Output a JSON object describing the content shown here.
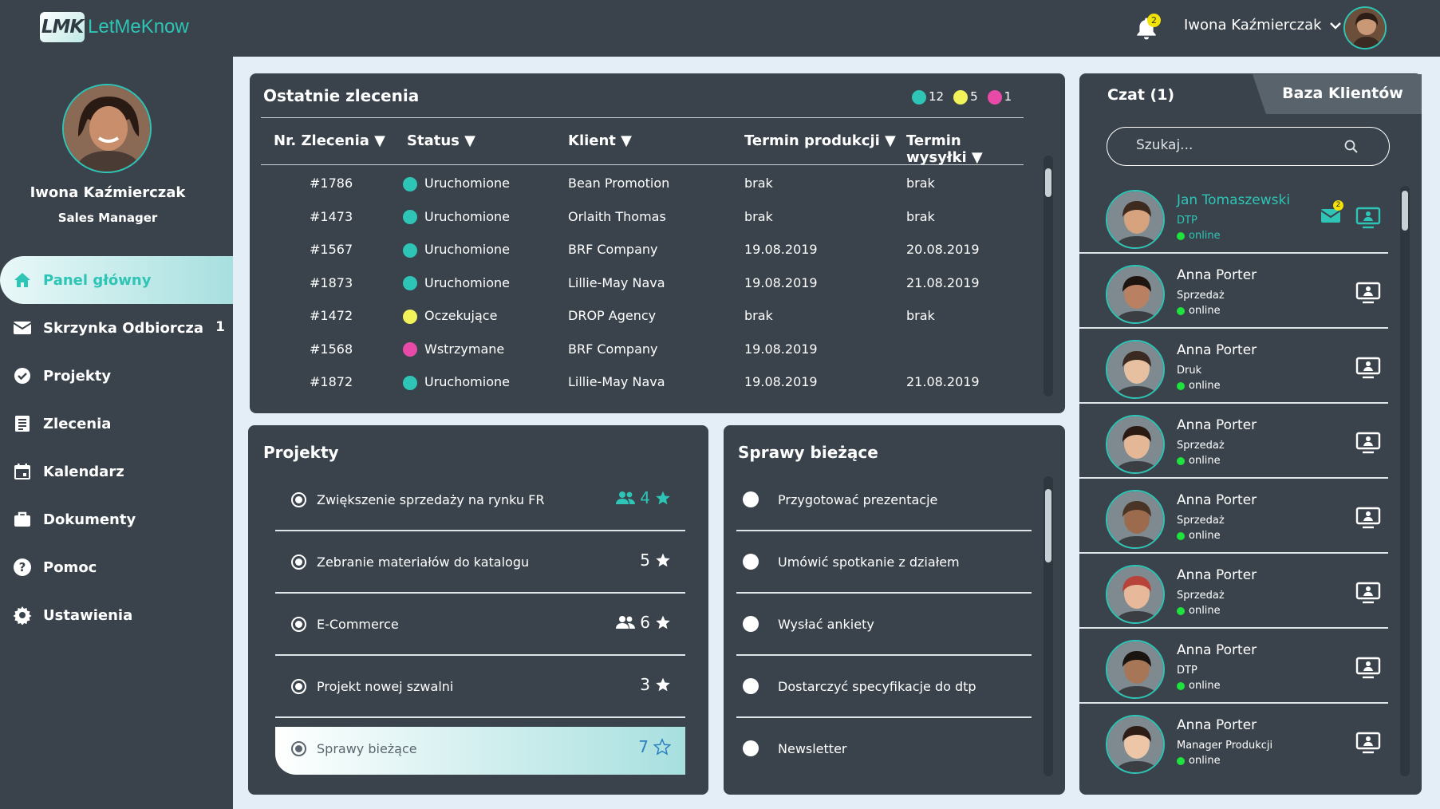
{
  "app": {
    "logo_mark": "LMK",
    "logo_name": "LetMeKnow"
  },
  "topbar": {
    "notifications_count": "2",
    "user_name": "Iwona Kaźmierczak"
  },
  "profile": {
    "name": "Iwona Kaźmierczak",
    "role": "Sales Manager"
  },
  "nav": {
    "items": [
      {
        "label": "Panel główny",
        "icon": "home-icon",
        "badge": ""
      },
      {
        "label": "Skrzynka Odbiorcza",
        "icon": "envelope-icon",
        "badge": "1"
      },
      {
        "label": "Projekty",
        "icon": "check-circle-icon",
        "badge": ""
      },
      {
        "label": "Zlecenia",
        "icon": "list-icon",
        "badge": ""
      },
      {
        "label": "Kalendarz",
        "icon": "calendar-icon",
        "badge": ""
      },
      {
        "label": "Dokumenty",
        "icon": "briefcase-icon",
        "badge": ""
      },
      {
        "label": "Pomoc",
        "icon": "help-icon",
        "badge": ""
      },
      {
        "label": "Ustawienia",
        "icon": "gear-icon",
        "badge": ""
      }
    ]
  },
  "orders": {
    "title": "Ostatnie zlecenia",
    "legend": [
      {
        "color": "#2ec4b6",
        "count": "12"
      },
      {
        "color": "#f2f25a",
        "count": "5"
      },
      {
        "color": "#e84aa8",
        "count": "1"
      }
    ],
    "columns": [
      "Nr. Zlecenia ▼",
      "Status ▼",
      "Klient ▼",
      "Termin produkcji ▼",
      "Termin wysyłki ▼"
    ],
    "rows": [
      {
        "nr": "#1786",
        "status": "Uruchomione",
        "color": "#2ec4b6",
        "client": "Bean Promotion",
        "prod": "brak",
        "ship": "brak"
      },
      {
        "nr": "#1473",
        "status": "Uruchomione",
        "color": "#2ec4b6",
        "client": "Orlaith Thomas",
        "prod": "brak",
        "ship": "brak"
      },
      {
        "nr": "#1567",
        "status": "Uruchomione",
        "color": "#2ec4b6",
        "client": "BRF Company",
        "prod": "19.08.2019",
        "ship": "20.08.2019"
      },
      {
        "nr": "#1873",
        "status": "Uruchomione",
        "color": "#2ec4b6",
        "client": "Lillie-May Nava",
        "prod": "19.08.2019",
        "ship": "21.08.2019"
      },
      {
        "nr": "#1472",
        "status": "Oczekujące",
        "color": "#f2f25a",
        "client": "DROP Agency",
        "prod": "brak",
        "ship": "brak"
      },
      {
        "nr": "#1568",
        "status": "Wstrzymane",
        "color": "#e84aa8",
        "client": "BRF Company",
        "prod": "19.08.2019",
        "ship": ""
      },
      {
        "nr": "#1872",
        "status": "Uruchomione",
        "color": "#2ec4b6",
        "client": "Lillie-May Nava",
        "prod": "19.08.2019",
        "ship": "21.08.2019"
      }
    ]
  },
  "projects": {
    "title": "Projekty",
    "items": [
      {
        "label": "Zwiększenie sprzedaży na rynku FR",
        "count": "4",
        "team": true,
        "highlight": true,
        "selected": false
      },
      {
        "label": "Zebranie materiałów do katalogu",
        "count": "5",
        "team": false,
        "highlight": false,
        "selected": false
      },
      {
        "label": "E-Commerce",
        "count": "6",
        "team": true,
        "highlight": false,
        "selected": false
      },
      {
        "label": "Projekt nowej szwalni",
        "count": "3",
        "team": false,
        "highlight": false,
        "selected": false
      },
      {
        "label": "Sprawy bieżące",
        "count": "7",
        "team": false,
        "highlight": false,
        "selected": true
      }
    ]
  },
  "tasks": {
    "title": "Sprawy bieżące",
    "items": [
      "Przygotować prezentacje",
      "Umówić spotkanie z działem",
      "Wysłać ankiety",
      "Dostarczyć specyfikacje do dtp",
      "Newsletter"
    ]
  },
  "chat": {
    "tab_chat": "Czat (1)",
    "tab_clients": "Baza Klientów",
    "search_placeholder": "Szukaj...",
    "contacts": [
      {
        "name": "Jan Tomaszewski",
        "dept": "DTP",
        "status": "online",
        "active": true,
        "unread": "2"
      },
      {
        "name": "Anna Porter",
        "dept": "Sprzedaż",
        "status": "online",
        "active": false,
        "unread": ""
      },
      {
        "name": "Anna Porter",
        "dept": "Druk",
        "status": "online",
        "active": false,
        "unread": ""
      },
      {
        "name": "Anna Porter",
        "dept": "Sprzedaż",
        "status": "online",
        "active": false,
        "unread": ""
      },
      {
        "name": "Anna Porter",
        "dept": "Sprzedaż",
        "status": "online",
        "active": false,
        "unread": ""
      },
      {
        "name": "Anna Porter",
        "dept": "Sprzedaż",
        "status": "online",
        "active": false,
        "unread": ""
      },
      {
        "name": "Anna Porter",
        "dept": "DTP",
        "status": "online",
        "active": false,
        "unread": ""
      },
      {
        "name": "Anna Porter",
        "dept": "Manager Produkcji",
        "status": "online",
        "active": false,
        "unread": ""
      }
    ]
  },
  "colors": {
    "accent": "#2ec4b6",
    "panel": "#3a434b",
    "background": "#e4eef7"
  }
}
